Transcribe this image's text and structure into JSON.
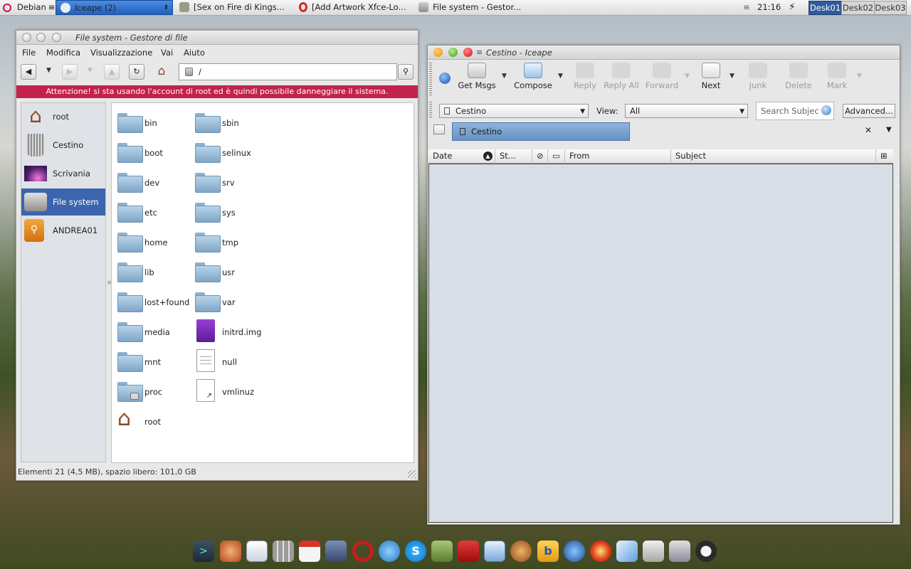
{
  "panel": {
    "debian_label": "Debian",
    "tasks": [
      "Iceape (2)",
      "[Sex on Fire di Kings...",
      "[Add Artwork Xfce-Lo...",
      "File system - Gestor..."
    ],
    "clock": "21:16",
    "desks": [
      "Desk01",
      "Desk02",
      "Desk03"
    ]
  },
  "fm": {
    "title": "File system - Gestore di file",
    "menu": [
      "File",
      "Modifica",
      "Visualizzazione",
      "Vai",
      "Aiuto"
    ],
    "path": "/",
    "warning": "Attenzione! si sta usando l'account di root ed è quindi possibile danneggiare il sistema.",
    "places": [
      "root",
      "Cestino",
      "Scrivania",
      "File system",
      "ANDREA01"
    ],
    "selected_place": "File system",
    "items_left": [
      "bin",
      "boot",
      "dev",
      "etc",
      "home",
      "lib",
      "lost+found",
      "media",
      "mnt",
      "proc",
      "root"
    ],
    "items_right": [
      "sbin",
      "selinux",
      "srv",
      "sys",
      "tmp",
      "usr",
      "var",
      "initrd.img",
      "null",
      "vmlinuz"
    ],
    "status": "Elementi 21 (4,5 MB), spazio libero: 101,0 GB"
  },
  "ic": {
    "title": "Cestino - Iceape",
    "toolbar": [
      "Get Msgs",
      "Compose",
      "Reply",
      "Reply All",
      "Forward",
      "Next",
      "Junk",
      "Delete",
      "Mark"
    ],
    "folder": "Cestino",
    "view_label": "View:",
    "view_value": "All",
    "search_placeholder": "Search Subjec",
    "advanced": "Advanced...",
    "tab": "Cestino",
    "columns": [
      "Date",
      "St...",
      "From",
      "Subject"
    ]
  },
  "colors": {
    "warning": "#c2224b",
    "selection": "#3b66ad",
    "desk_active": "#2f5b9c"
  },
  "dock_icons": [
    "terminal-icon",
    "home-icon",
    "text-editor-icon",
    "calculator-icon",
    "calendar-icon",
    "gimp-icon",
    "opera-icon",
    "pidgin-icon",
    "skype-icon",
    "android-icon",
    "acrobat-icon",
    "image-viewer-icon",
    "gecko-icon",
    "bluefish-icon",
    "media-player-icon",
    "burner-icon",
    "mail-icon",
    "printer-icon",
    "scanner-icon",
    "tux-icon"
  ]
}
